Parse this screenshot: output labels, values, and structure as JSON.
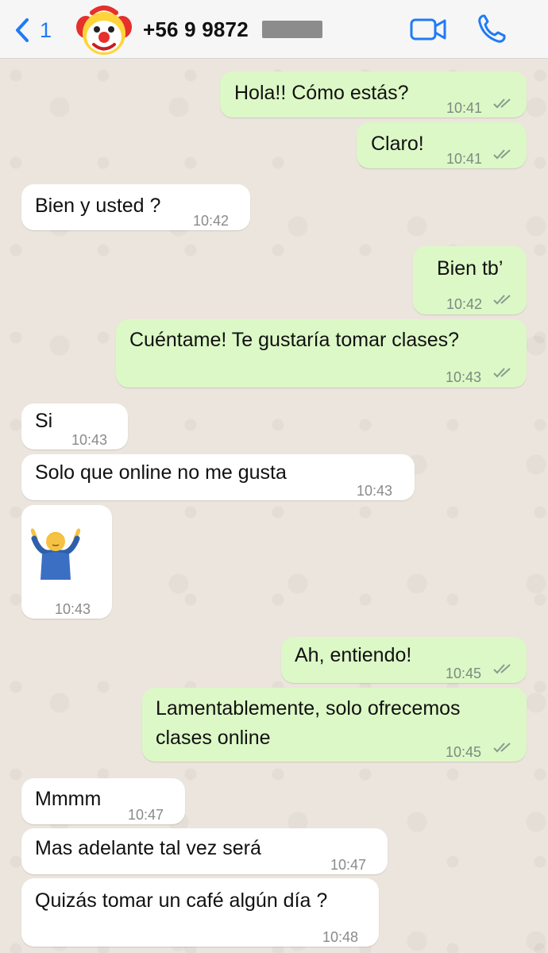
{
  "header": {
    "back_count": "1",
    "contact_name": "+56 9 9872"
  },
  "messages": [
    {
      "dir": "out",
      "text": "Hola!! Cómo estás?",
      "time": "10:41",
      "status": "read"
    },
    {
      "dir": "out",
      "text": "Claro!",
      "time": "10:41",
      "status": "read"
    },
    {
      "dir": "in",
      "text": "Bien y usted ?",
      "time": "10:42"
    },
    {
      "dir": "out",
      "text": "Bien tb’",
      "time": "10:42",
      "status": "read"
    },
    {
      "dir": "out",
      "text": "Cuéntame! Te gustaría tomar clases?",
      "time": "10:43",
      "status": "read"
    },
    {
      "dir": "in",
      "text": "Si",
      "time": "10:43"
    },
    {
      "dir": "in",
      "text": "Solo que online no me gusta",
      "time": "10:43"
    },
    {
      "dir": "in",
      "text": "🤷‍♂️",
      "time": "10:43",
      "type": "emoji",
      "icon": "person-shrugging-emoji"
    },
    {
      "dir": "out",
      "text": "Ah, entiendo!",
      "time": "10:45",
      "status": "read"
    },
    {
      "dir": "out",
      "text_lines": [
        "Lamentablemente, solo ofrecemos",
        "clases online"
      ],
      "time": "10:45",
      "status": "read"
    },
    {
      "dir": "in",
      "text": "Mmmm",
      "time": "10:47"
    },
    {
      "dir": "in",
      "text": "Mas adelante tal vez será",
      "time": "10:47"
    },
    {
      "dir": "in",
      "text": "Quizás tomar un café algún día ?",
      "time": "10:48"
    }
  ],
  "colors": {
    "accent": "#1f7bf6",
    "outgoing_bubble": "#dcf8c6",
    "incoming_bubble": "#ffffff",
    "wallpaper": "#ece5dd",
    "read_ticks": "#8a9a8e"
  }
}
